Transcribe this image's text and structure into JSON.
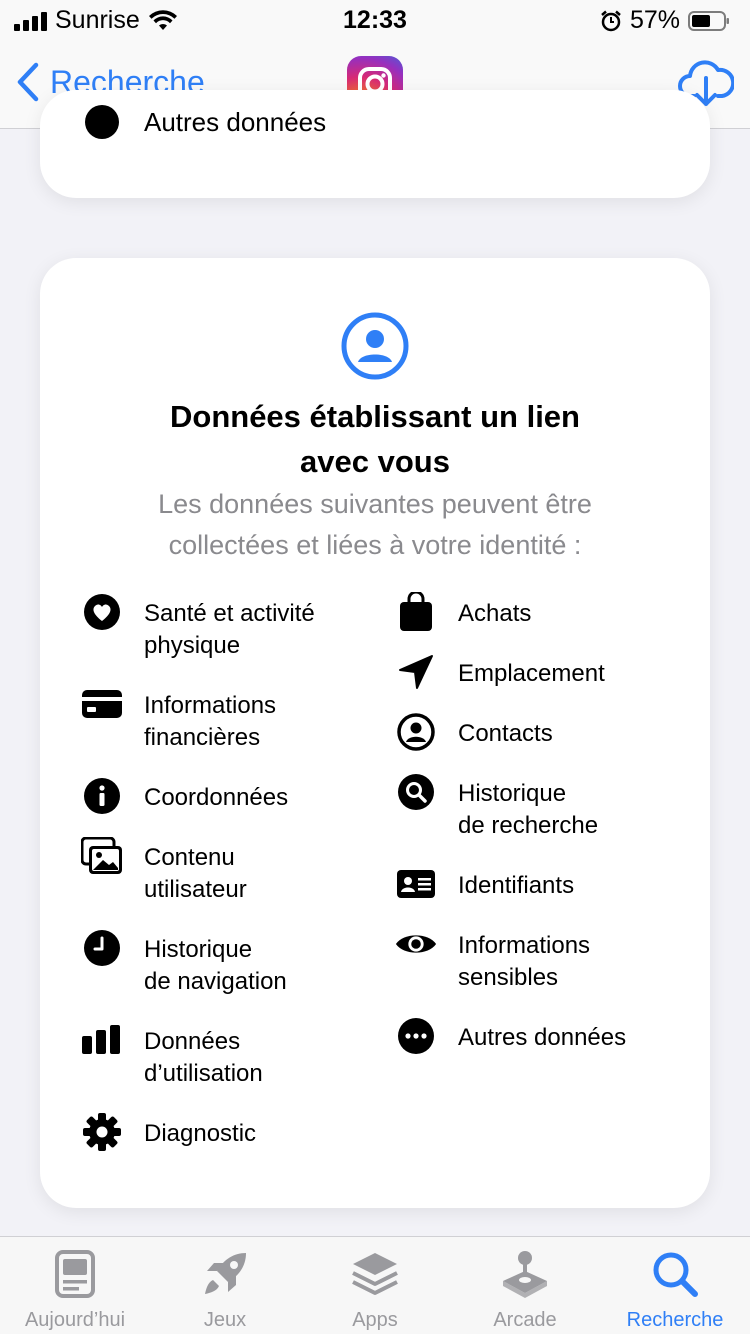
{
  "status_bar": {
    "carrier": "Sunrise",
    "time": "12:33",
    "battery": "57%"
  },
  "nav": {
    "back_label": "Recherche",
    "app_icon": "instagram-app-icon",
    "action_icon": "cloud-download-icon"
  },
  "top_card": {
    "partial_label": "Autres données"
  },
  "privacy_card": {
    "title_line1": "Données établissant un lien",
    "title_line2": "avec vous",
    "subtitle_line1": "Les données suivantes peuvent être",
    "subtitle_line2": "collectées et liées à votre identité :",
    "left_items": [
      {
        "icon": "heart-icon",
        "label": "Santé et activité\nphysique"
      },
      {
        "icon": "credit-card-icon",
        "label": "Informations\nfinancières"
      },
      {
        "icon": "info-icon",
        "label": "Coordonnées"
      },
      {
        "icon": "photos-icon",
        "label": "Contenu\nutilisateur"
      },
      {
        "icon": "clock-icon",
        "label": "Historique\nde navigation"
      },
      {
        "icon": "bar-chart-icon",
        "label": "Données\nd’utilisation"
      },
      {
        "icon": "gear-icon",
        "label": "Diagnostic"
      }
    ],
    "right_items": [
      {
        "icon": "bag-icon",
        "label": "Achats"
      },
      {
        "icon": "location-arrow-icon",
        "label": "Emplacement"
      },
      {
        "icon": "person-circle-icon",
        "label": "Contacts"
      },
      {
        "icon": "search-circle-icon",
        "label": "Historique\nde recherche"
      },
      {
        "icon": "id-card-icon",
        "label": "Identifiants"
      },
      {
        "icon": "eye-icon",
        "label": "Informations\nsensibles"
      },
      {
        "icon": "ellipsis-circle-icon",
        "label": "Autres données"
      }
    ]
  },
  "tab_bar": {
    "tabs": [
      {
        "label": "Aujourd’hui",
        "icon": "today-icon"
      },
      {
        "label": "Jeux",
        "icon": "rocket-icon"
      },
      {
        "label": "Apps",
        "icon": "apps-stack-icon"
      },
      {
        "label": "Arcade",
        "icon": "joystick-icon"
      },
      {
        "label": "Recherche",
        "icon": "search-icon"
      }
    ],
    "active_tab": "Recherche"
  },
  "colors": {
    "accent": "#2f7ff6",
    "tab_inactive": "#9a9a9e",
    "subtitle": "#8a8a8e",
    "background": "#f2f2f7"
  }
}
